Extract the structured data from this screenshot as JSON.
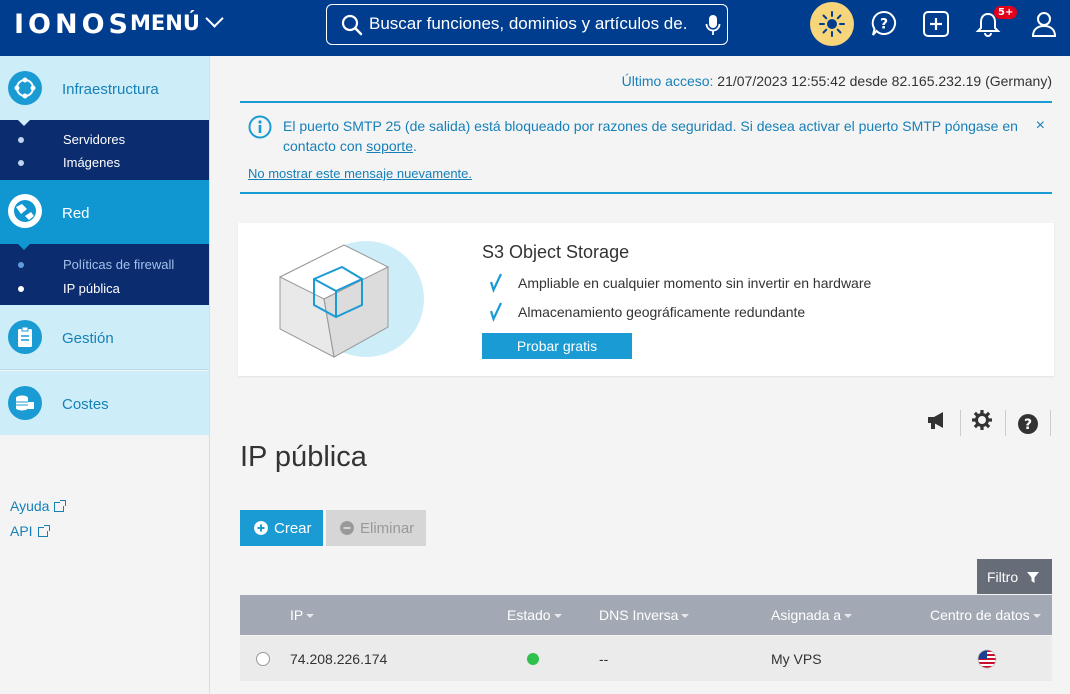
{
  "header": {
    "logo": "IONOS",
    "menu_label": "MENÚ",
    "search_placeholder": "Buscar funciones, dominios y artículos de...",
    "notif_badge": "5+",
    "icons": [
      "sun-icon",
      "help-icon",
      "plus-icon",
      "bell-icon",
      "user-icon"
    ]
  },
  "sidebar": {
    "sections": [
      {
        "label": "Infraestructura",
        "icon": "infrastructure-icon"
      },
      {
        "label": "Red",
        "icon": "network-icon"
      },
      {
        "label": "Gestión",
        "icon": "clipboard-icon"
      },
      {
        "label": "Costes",
        "icon": "coins-icon"
      }
    ],
    "infra_items": [
      "Servidores",
      "Imágenes"
    ],
    "red_items": [
      "Políticas de firewall",
      "IP pública"
    ],
    "links": [
      "Ayuda",
      "API"
    ]
  },
  "last_access": {
    "label": "Último acceso:",
    "value": "21/07/2023 12:55:42 desde 82.165.232.19 (Germany)"
  },
  "alert": {
    "text_before": "El puerto SMTP 25 (de salida) está bloqueado por razones de seguridad. Si desea activar el puerto SMTP póngase en contacto con ",
    "link": "soporte",
    "text_after": ".",
    "dismiss": "No mostrar este mensaje nuevamente.",
    "close": "×"
  },
  "promo": {
    "title": "S3 Object Storage",
    "features": [
      "Ampliable en cualquier momento sin invertir en hardware",
      "Almacenamiento geográficamente redundante"
    ],
    "cta": "Probar gratis"
  },
  "page": {
    "title": "IP pública",
    "create": "Crear",
    "delete": "Eliminar",
    "filter": "Filtro"
  },
  "table": {
    "columns": [
      "IP",
      "Estado",
      "DNS Inversa",
      "Asignada a",
      "Centro de datos"
    ],
    "rows": [
      {
        "ip": "74.208.226.174",
        "dns": "--",
        "assigned": "My VPS",
        "status_color": "#2fc14b",
        "datacenter": "us-flag-icon"
      }
    ]
  },
  "colors": {
    "brand": "#003d8f",
    "accent": "#1b9bd4",
    "nav_dark": "#0b2c6e"
  }
}
